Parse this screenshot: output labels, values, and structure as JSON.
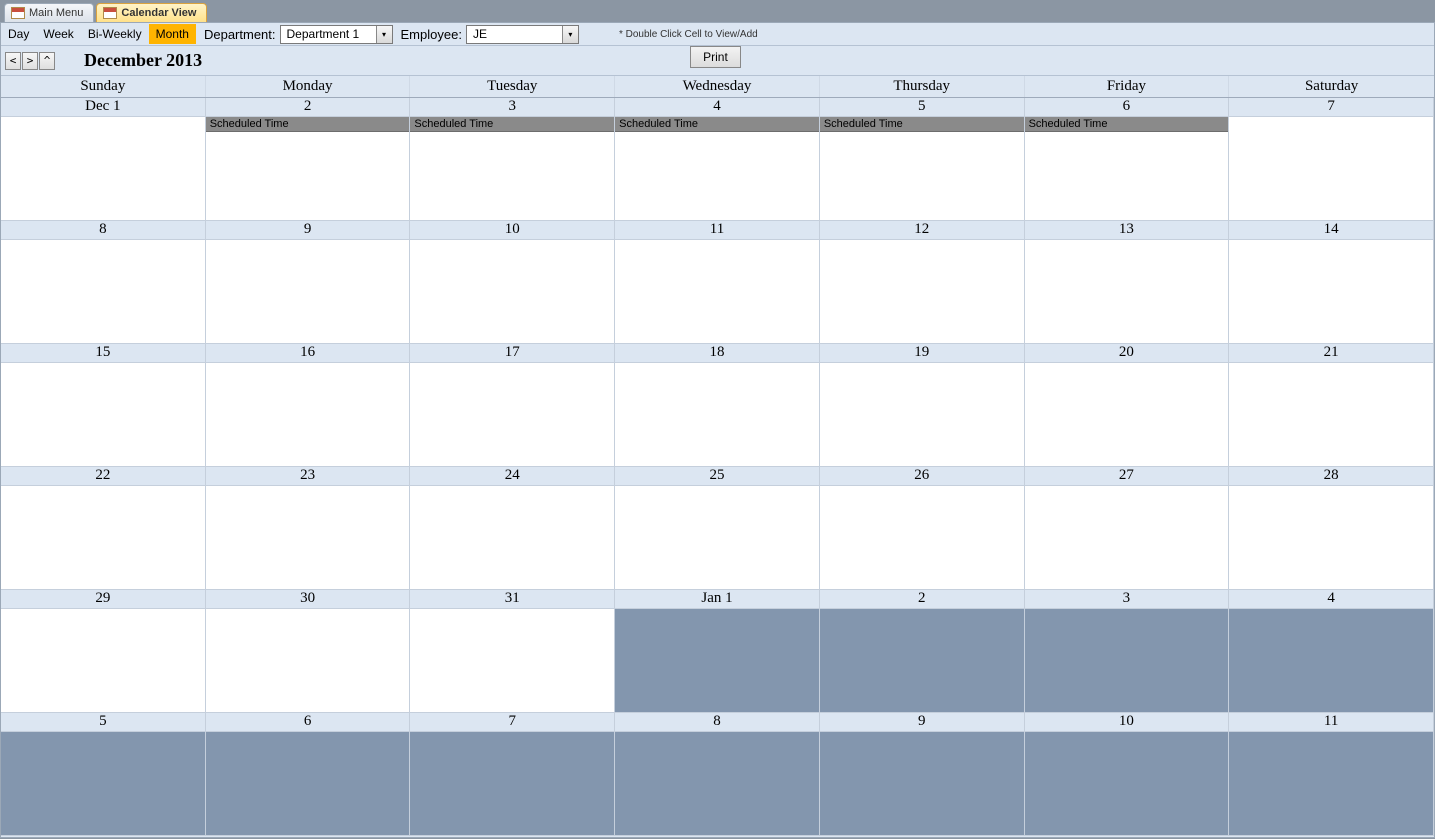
{
  "tabs": [
    {
      "label": "Main Menu",
      "active": false
    },
    {
      "label": "Calendar View",
      "active": true
    }
  ],
  "viewModes": {
    "day": "Day",
    "week": "Week",
    "biweekly": "Bi-Weekly",
    "month": "Month"
  },
  "activeViewMode": "month",
  "toolbar": {
    "departmentLabel": "Department:",
    "departmentValue": "Department 1",
    "employeeLabel": "Employee:",
    "employeeValue": "JE",
    "hint": "* Double Click Cell to View/Add"
  },
  "nav": {
    "prev": "<",
    "next": ">",
    "up": "^",
    "title": "December 2013",
    "printLabel": "Print"
  },
  "dayNames": [
    "Sunday",
    "Monday",
    "Tuesday",
    "Wednesday",
    "Thursday",
    "Friday",
    "Saturday"
  ],
  "weeks": [
    [
      {
        "label": "Dec 1",
        "outside": false,
        "events": []
      },
      {
        "label": "2",
        "outside": false,
        "events": [
          "Scheduled Time"
        ]
      },
      {
        "label": "3",
        "outside": false,
        "events": [
          "Scheduled Time"
        ]
      },
      {
        "label": "4",
        "outside": false,
        "events": [
          "Scheduled Time"
        ]
      },
      {
        "label": "5",
        "outside": false,
        "events": [
          "Scheduled Time"
        ]
      },
      {
        "label": "6",
        "outside": false,
        "events": [
          "Scheduled Time"
        ]
      },
      {
        "label": "7",
        "outside": false,
        "events": []
      }
    ],
    [
      {
        "label": "8",
        "outside": false,
        "events": []
      },
      {
        "label": "9",
        "outside": false,
        "events": []
      },
      {
        "label": "10",
        "outside": false,
        "events": []
      },
      {
        "label": "11",
        "outside": false,
        "events": []
      },
      {
        "label": "12",
        "outside": false,
        "events": []
      },
      {
        "label": "13",
        "outside": false,
        "events": []
      },
      {
        "label": "14",
        "outside": false,
        "events": []
      }
    ],
    [
      {
        "label": "15",
        "outside": false,
        "events": []
      },
      {
        "label": "16",
        "outside": false,
        "events": []
      },
      {
        "label": "17",
        "outside": false,
        "events": []
      },
      {
        "label": "18",
        "outside": false,
        "events": []
      },
      {
        "label": "19",
        "outside": false,
        "events": []
      },
      {
        "label": "20",
        "outside": false,
        "events": []
      },
      {
        "label": "21",
        "outside": false,
        "events": []
      }
    ],
    [
      {
        "label": "22",
        "outside": false,
        "events": []
      },
      {
        "label": "23",
        "outside": false,
        "events": []
      },
      {
        "label": "24",
        "outside": false,
        "events": []
      },
      {
        "label": "25",
        "outside": false,
        "events": []
      },
      {
        "label": "26",
        "outside": false,
        "events": []
      },
      {
        "label": "27",
        "outside": false,
        "events": []
      },
      {
        "label": "28",
        "outside": false,
        "events": []
      }
    ],
    [
      {
        "label": "29",
        "outside": false,
        "events": []
      },
      {
        "label": "30",
        "outside": false,
        "events": []
      },
      {
        "label": "31",
        "outside": false,
        "events": []
      },
      {
        "label": "Jan 1",
        "outside": true,
        "events": []
      },
      {
        "label": "2",
        "outside": true,
        "events": []
      },
      {
        "label": "3",
        "outside": true,
        "events": []
      },
      {
        "label": "4",
        "outside": true,
        "events": []
      }
    ],
    [
      {
        "label": "5",
        "outside": true,
        "events": []
      },
      {
        "label": "6",
        "outside": true,
        "events": []
      },
      {
        "label": "7",
        "outside": true,
        "events": []
      },
      {
        "label": "8",
        "outside": true,
        "events": []
      },
      {
        "label": "9",
        "outside": true,
        "events": []
      },
      {
        "label": "10",
        "outside": true,
        "events": []
      },
      {
        "label": "11",
        "outside": true,
        "events": []
      }
    ]
  ]
}
